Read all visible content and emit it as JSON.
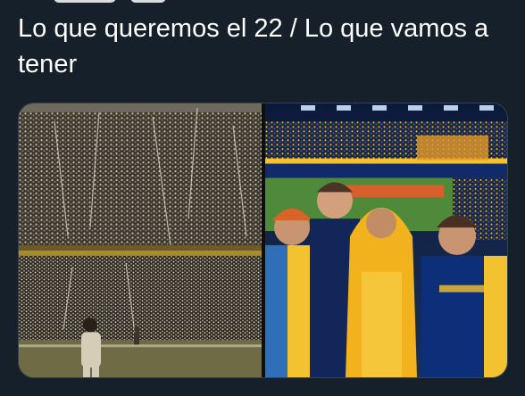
{
  "tweet": {
    "text": "Lo que queremos el 22 / Lo que vamos a tener"
  },
  "media": {
    "count": 2,
    "colors": {
      "boca_blue": "#0d2f7a",
      "boca_gold": "#f2c230",
      "pitch_green": "#5a8f3a",
      "background": "#15202b",
      "text": "#ffffff"
    },
    "icons": [
      "photo-icon",
      "photo-icon"
    ]
  }
}
